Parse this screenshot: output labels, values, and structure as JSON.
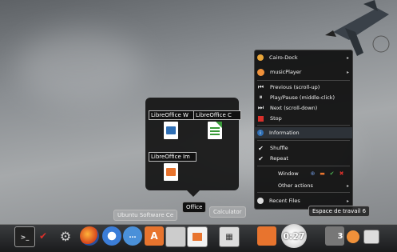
{
  "stack": {
    "name": "Office",
    "apps": [
      {
        "label": "LibreOffice W"
      },
      {
        "label": "LibreOffice C"
      },
      {
        "label": "LibreOffice Im"
      }
    ]
  },
  "dock_labels": {
    "software_center": "Ubuntu Software Ce",
    "office": "Office",
    "calculator": "Calculator",
    "workspace": "Espace de travail 6"
  },
  "clock": {
    "time": "0:27"
  },
  "workspace_number": "3",
  "menu": {
    "cairo_dock": "Cairo-Dock",
    "music_player": "musicPlayer",
    "previous": "Previous (scroll-up)",
    "play_pause": "Play/Pause (middle-click)",
    "next": "Next (scroll-down)",
    "stop": "Stop",
    "information": "Information",
    "shuffle": "Shuffle",
    "repeat": "Repeat",
    "window": "Window",
    "other_actions": "Other actions",
    "recent_files": "Recent Files"
  },
  "colors": {
    "stop": "#d9302b",
    "info": "#2f6fb5",
    "accent_orange": "#e8742e"
  }
}
